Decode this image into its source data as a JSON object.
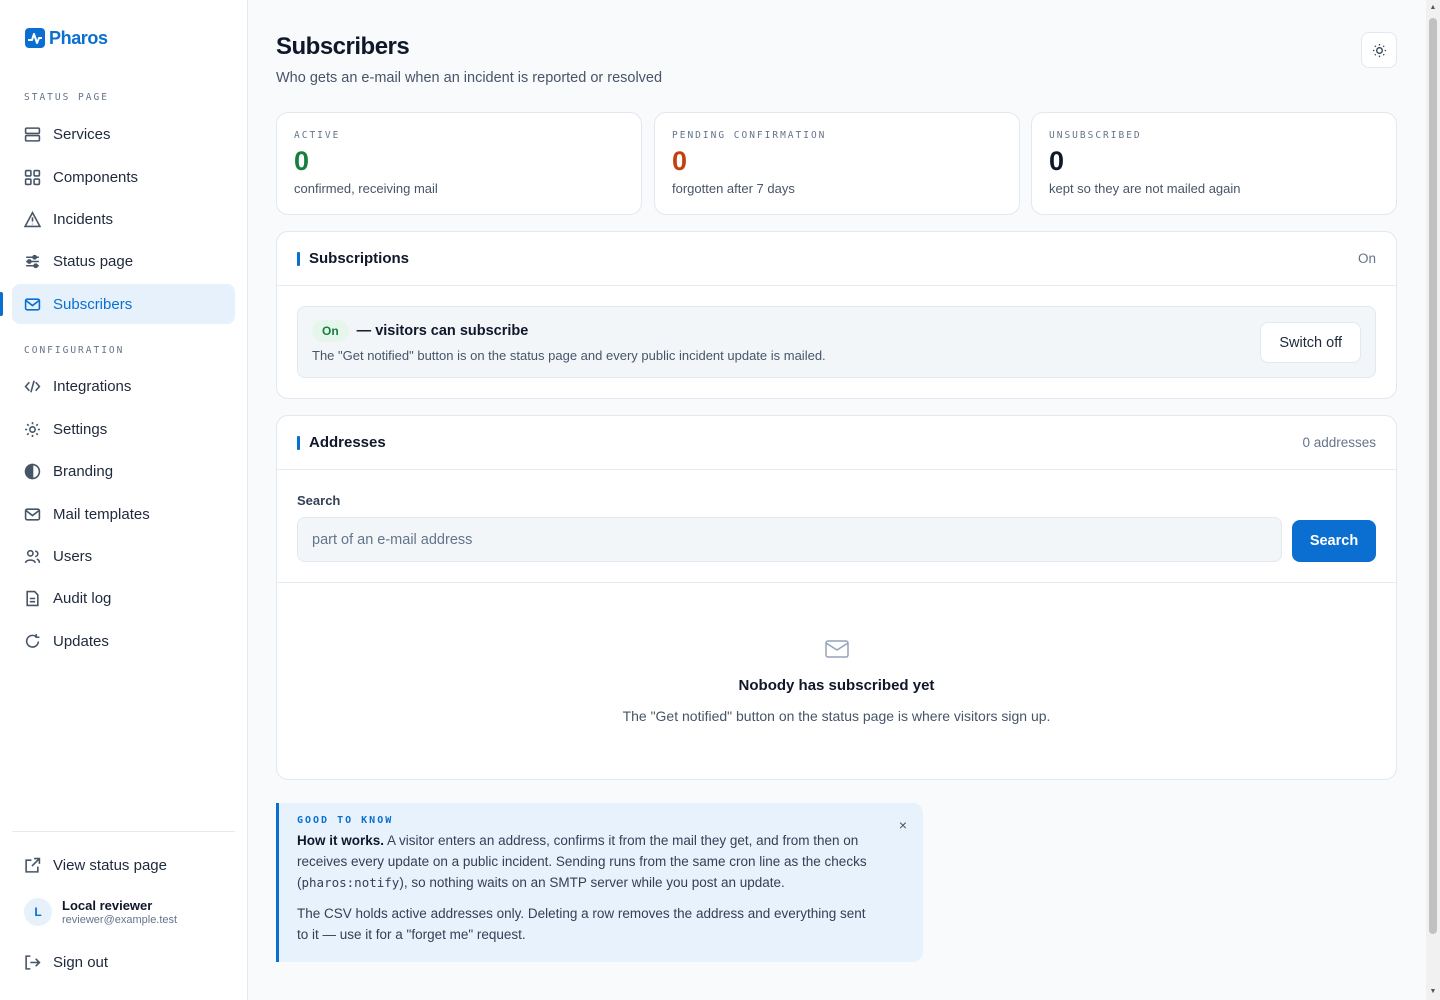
{
  "app": {
    "name": "Pharos"
  },
  "sidebar": {
    "section_status": "STATUS PAGE",
    "section_config": "CONFIGURATION",
    "items": [
      {
        "label": "Services",
        "icon": "server-icon"
      },
      {
        "label": "Components",
        "icon": "grid-icon"
      },
      {
        "label": "Incidents",
        "icon": "alert-triangle-icon"
      },
      {
        "label": "Status page",
        "icon": "sliders-icon"
      },
      {
        "label": "Subscribers",
        "icon": "mail-icon",
        "active": true
      },
      {
        "label": "Integrations",
        "icon": "code-icon"
      },
      {
        "label": "Settings",
        "icon": "gear-icon"
      },
      {
        "label": "Branding",
        "icon": "contrast-icon"
      },
      {
        "label": "Mail templates",
        "icon": "mail-icon"
      },
      {
        "label": "Users",
        "icon": "users-icon"
      },
      {
        "label": "Audit log",
        "icon": "file-icon"
      },
      {
        "label": "Updates",
        "icon": "refresh-icon"
      }
    ],
    "view_status": "View status page",
    "user": {
      "initial": "L",
      "name": "Local reviewer",
      "email": "reviewer@example.test"
    },
    "sign_out": "Sign out"
  },
  "header": {
    "title": "Subscribers",
    "subtitle": "Who gets an e-mail when an incident is reported or resolved"
  },
  "stats": [
    {
      "label": "ACTIVE",
      "value": "0",
      "desc": "confirmed, receiving mail",
      "color": "#15803d"
    },
    {
      "label": "PENDING CONFIRMATION",
      "value": "0",
      "desc": "forgotten after 7 days",
      "color": "#c2410c"
    },
    {
      "label": "UNSUBSCRIBED",
      "value": "0",
      "desc": "kept so they are not mailed again",
      "color": "#0f172a"
    }
  ],
  "subscriptions": {
    "title": "Subscriptions",
    "status": "On",
    "badge": "On",
    "headline": "— visitors can subscribe",
    "desc": "The \"Get notified\" button is on the status page and every public incident update is mailed.",
    "button": "Switch off"
  },
  "addresses": {
    "title": "Addresses",
    "count": "0 addresses",
    "search_label": "Search",
    "search_placeholder": "part of an e-mail address",
    "search_button": "Search",
    "empty_title": "Nobody has subscribed yet",
    "empty_desc": "The \"Get notified\" button on the status page is where visitors sign up."
  },
  "info": {
    "label": "GOOD TO KNOW",
    "bold": "How it works.",
    "p1a": " A visitor enters an address, confirms it from the mail they get, and from then on receives every update on a public incident. Sending runs from the same cron line as the checks (",
    "code": "pharos:notify",
    "p1b": "), so nothing waits on an SMTP server while you post an update.",
    "p2": "The CSV holds active addresses only. Deleting a row removes the address and everything sent to it — use it for a \"forget me\" request.",
    "close": "×"
  },
  "colors": {
    "accent": "#0a6fd1",
    "success": "#15803d",
    "warning": "#c2410c"
  }
}
